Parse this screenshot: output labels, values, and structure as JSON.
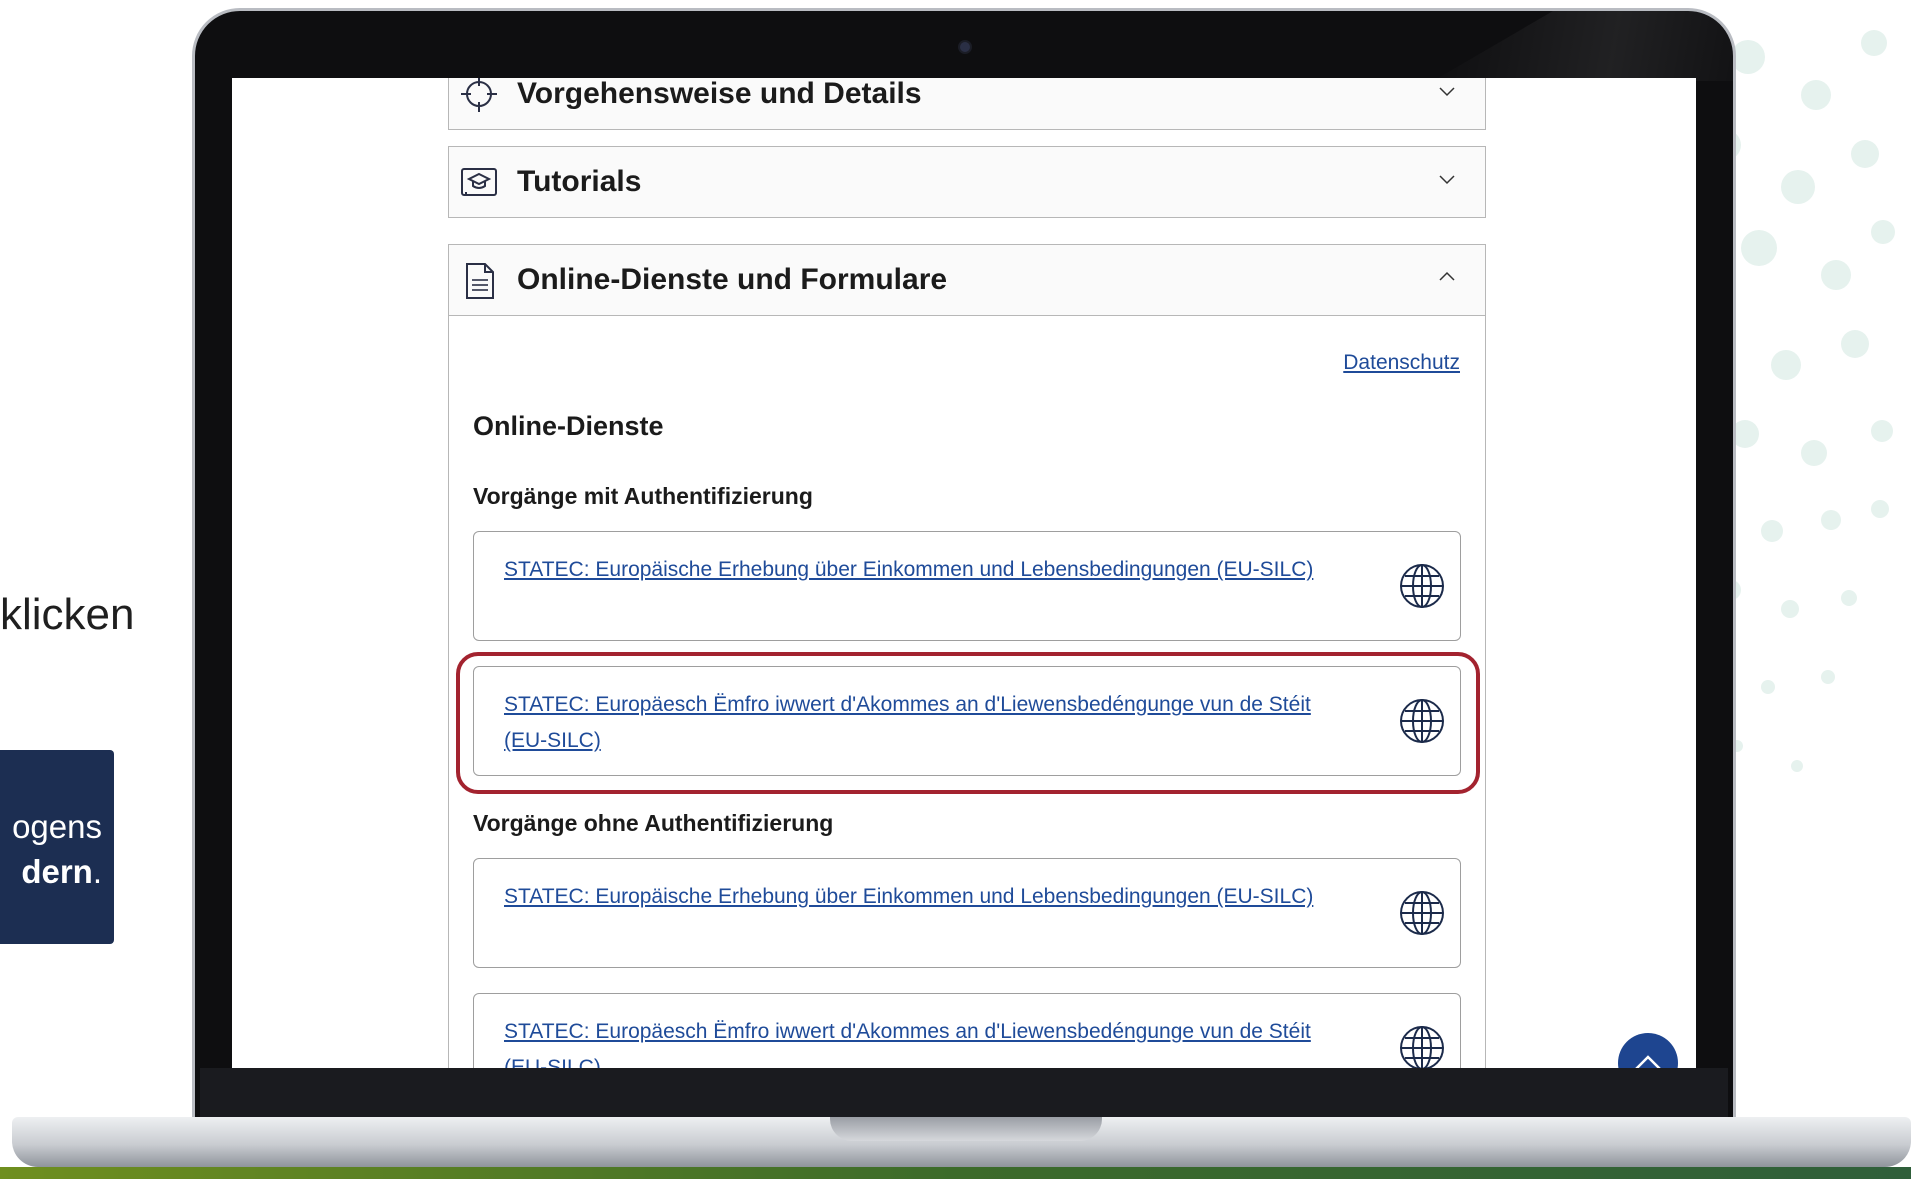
{
  "slide": {
    "left_text": "klicken",
    "box_line1": "ogens",
    "box_line2_bold": "dern",
    "box_line2_tail": "."
  },
  "accordions": {
    "procedure_title": "Vorgehensweise und Details",
    "tutorials_title": "Tutorials",
    "online_title": "Online-Dienste und Formulare",
    "procedure_icon": "target-icon",
    "tutorials_icon": "graduation-cap-icon",
    "online_icon": "document-icon"
  },
  "panel": {
    "privacy_link": "Datenschutz",
    "heading": "Online-Dienste",
    "with_auth_heading": "Vorgänge mit Authentifizierung",
    "without_auth_heading": "Vorgänge ohne Authentifizierung",
    "with_auth_services": [
      "STATEC: Europäische Erhebung über Einkommen und Lebensbedingungen (EU-SILC)",
      "STATEC: Europäesch Ëmfro iwwert d'Akommes an d'Liewensbedéngunge vun de Stéit (EU-SILC)"
    ],
    "without_auth_services": [
      "STATEC: Europäische Erhebung über Einkommen und Lebensbedingungen (EU-SILC)",
      "STATEC: Europäesch Ëmfro iwwert d'Akommes an d'Liewensbedéngunge vun de Stéit (EU-SILC)"
    ],
    "service_icon": "globe-icon"
  },
  "colors": {
    "link": "#1f4b99",
    "highlight": "#a3232f",
    "back_to_top": "#1e4590",
    "slide_box": "#1c2e52"
  }
}
